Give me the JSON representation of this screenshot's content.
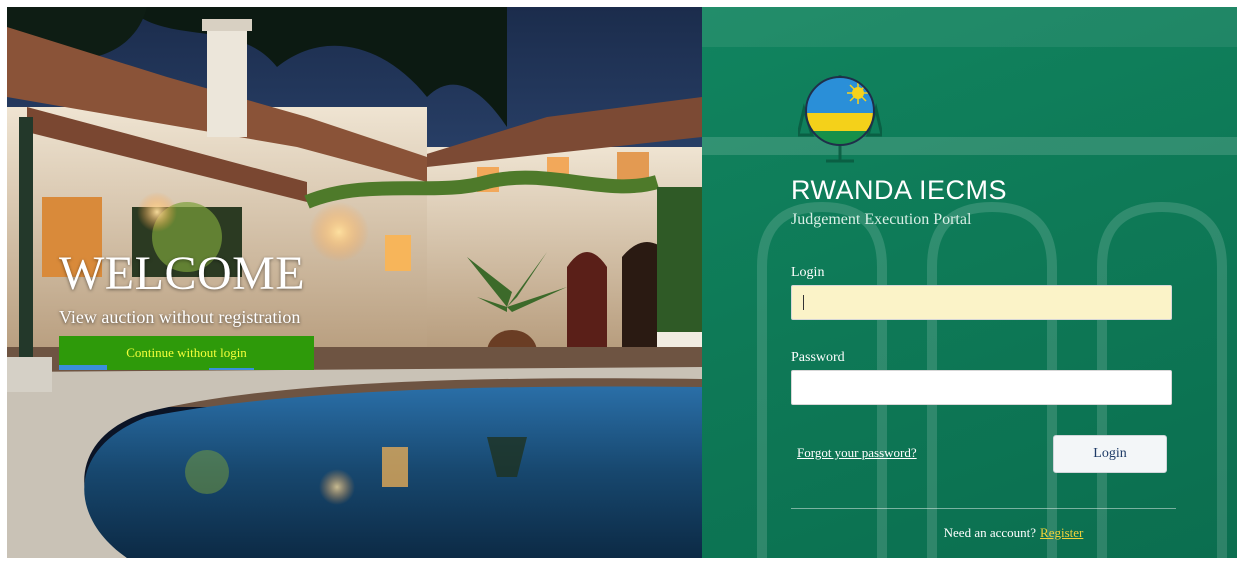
{
  "hero": {
    "welcome": "WELCOME",
    "subtitle": "View auction without registration",
    "continue_label": "Continue without login"
  },
  "portal": {
    "title": "RWANDA IECMS",
    "subtitle": "Judgement Execution Portal"
  },
  "form": {
    "login_label": "Login",
    "login_value": "",
    "password_label": "Password",
    "password_value": "",
    "forgot_label": "Forgot your password?",
    "submit_label": "Login"
  },
  "footer": {
    "prompt": "Need an account?",
    "register_label": "Register"
  },
  "colors": {
    "panel_green": "#0e7a57",
    "continue_button": "#2e9a0a",
    "continue_text": "#f4ff3a",
    "register_link": "#f0d23a",
    "autofill_field": "#fbf3c8"
  },
  "icons": {
    "emblem": "rwanda-flag-emblem-icon",
    "caret": "text-cursor"
  }
}
